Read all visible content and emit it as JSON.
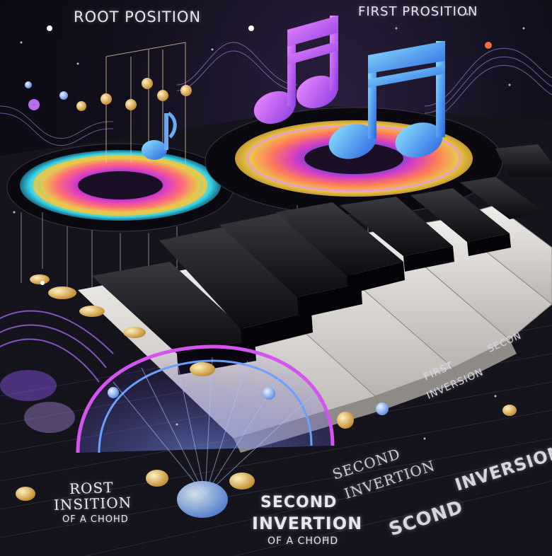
{
  "labels": {
    "root_position": "ROOT POSITION",
    "first_prosition": "FIRST PROSITION",
    "rost": "ROST",
    "insition": "INSITION",
    "of_a_chohd_left": "OF A CHOHD",
    "second": "SECOND",
    "invertion": "INVERTION",
    "of_a_chohd_center": "OF A CHOHD",
    "second_diag": "SECOND",
    "invertion_diag": "INVERTION",
    "first_right": "FIRST",
    "inversion_right": "INVERSION",
    "seco_right": "SECON",
    "scond": "SCOND",
    "inversion_big": "INVERSION"
  },
  "colors": {
    "note_pink": "#d45cf0",
    "note_blue": "#4aa0f0",
    "ring_cyan": "#38d6e8",
    "ring_yellow": "#e8c84a",
    "ring_magenta": "#d43cc8",
    "key_black": "#151418",
    "key_white": "#dcdad8",
    "glow_purple": "#9a5cff",
    "bead_gold": "#e8b84a"
  },
  "icons": [
    "music-note-pink-icon",
    "music-note-blue-icon",
    "music-note-small-icon"
  ]
}
